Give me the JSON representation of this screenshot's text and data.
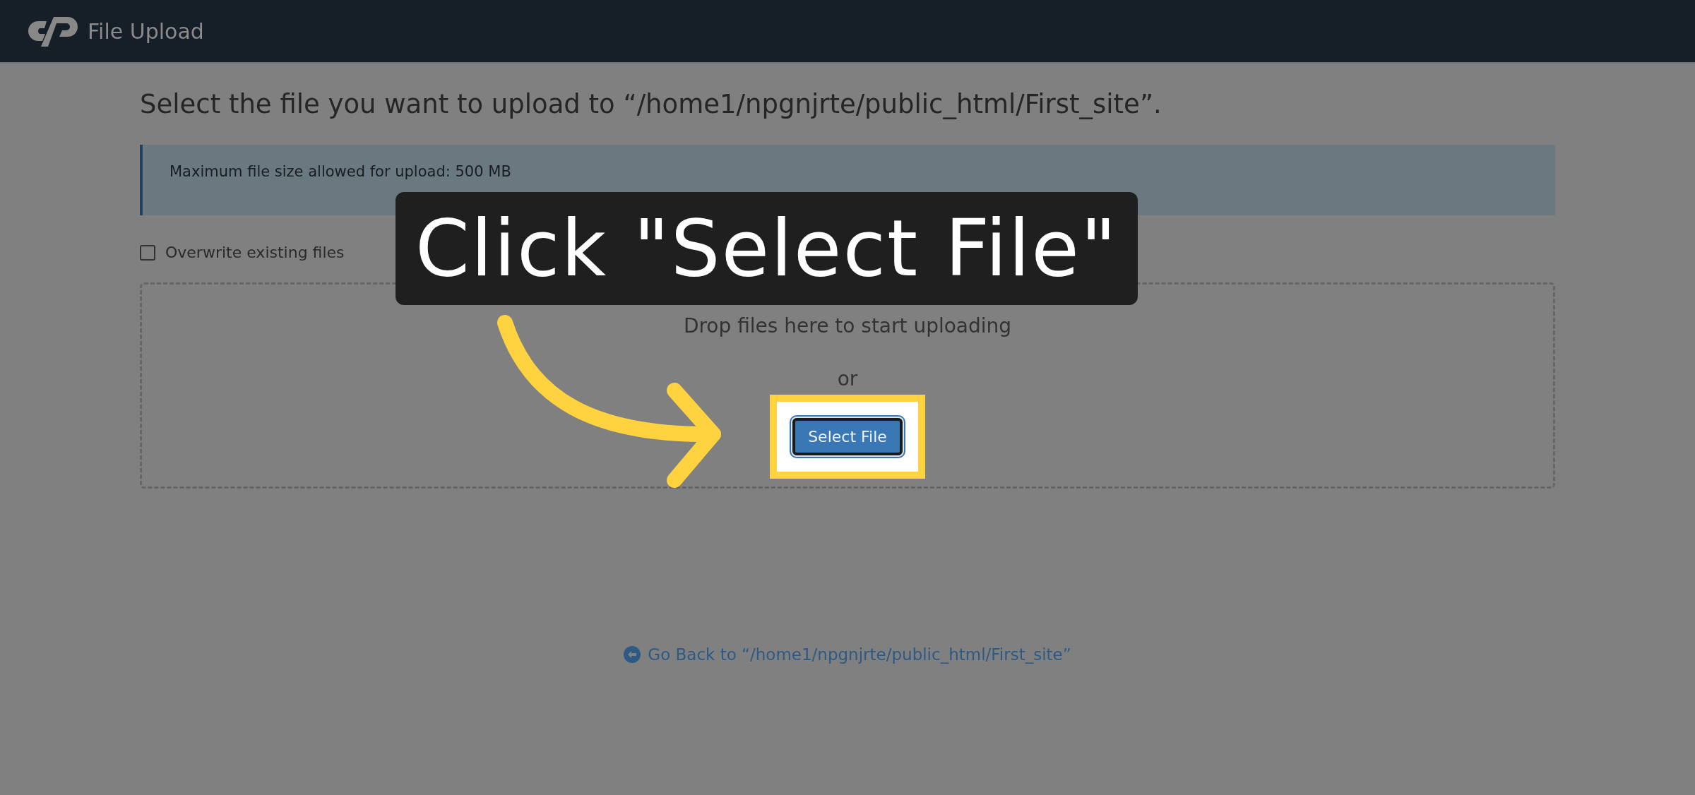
{
  "header": {
    "title": "File Upload"
  },
  "heading": "Select the file you want to upload to “/home1/npgnjrte/public_html/First_site”.",
  "notice": "Maximum file size allowed for upload: 500 MB",
  "overwrite": {
    "label": "Overwrite existing files",
    "checked": false
  },
  "dropzone": {
    "prompt": "Drop files here to start uploading",
    "separator": "or",
    "button": {
      "label": "Select File",
      "highlighted": true
    }
  },
  "back_link": "Go Back to “/home1/npgnjrte/public_html/First_site”",
  "callout": {
    "text": "Click \"Select File\""
  }
}
